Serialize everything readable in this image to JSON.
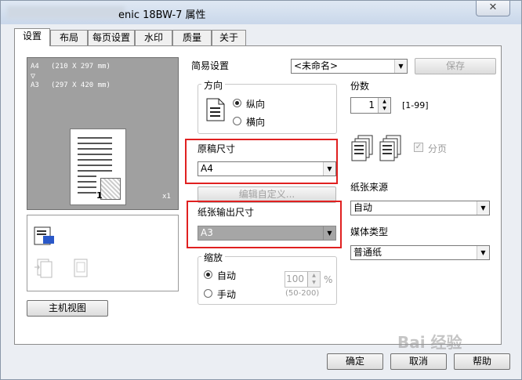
{
  "window": {
    "title": "enic 18BW-7 属性",
    "close_glyph": "✕"
  },
  "tabs": [
    {
      "label": "设置",
      "active": true
    },
    {
      "label": "布局"
    },
    {
      "label": "每页设置"
    },
    {
      "label": "水印"
    },
    {
      "label": "质量"
    },
    {
      "label": "关于"
    }
  ],
  "preview": {
    "line1_size": "A4",
    "line1_dims": "(210 X 297 mm)",
    "arrow": "▽",
    "line2_size": "A3",
    "line2_dims": "(297 X 420 mm)",
    "page_number": "1",
    "copies_mark": "x1"
  },
  "main_view_button": "主机视图",
  "easy_setup": {
    "label": "简易设置",
    "value": "<未命名>",
    "save": "保存"
  },
  "orientation": {
    "legend": "方向",
    "portrait": "纵向",
    "landscape": "横向",
    "selected": "portrait"
  },
  "original_size": {
    "label": "原稿尺寸",
    "value": "A4"
  },
  "edit_custom_button": "编辑自定义...",
  "output_size": {
    "label": "纸张输出尺寸",
    "value": "A3"
  },
  "zoom": {
    "legend": "缩放",
    "auto": "自动",
    "manual": "手动",
    "value": "100",
    "unit": "%",
    "range": "(50-200)",
    "selected": "auto"
  },
  "copies": {
    "label": "份数",
    "value": "1",
    "range": "[1-99]"
  },
  "collate": {
    "label": "分页",
    "checked": true,
    "check_glyph": "✓"
  },
  "paper_source": {
    "label": "纸张来源",
    "value": "自动"
  },
  "media_type": {
    "label": "媒体类型",
    "value": "普通纸"
  },
  "footer": {
    "ok": "确定",
    "cancel": "取消",
    "help": "帮助"
  },
  "watermark": "Bai 经验",
  "colors": {
    "highlight_box": "#e02020",
    "preview_bg": "#a0a0a0"
  }
}
